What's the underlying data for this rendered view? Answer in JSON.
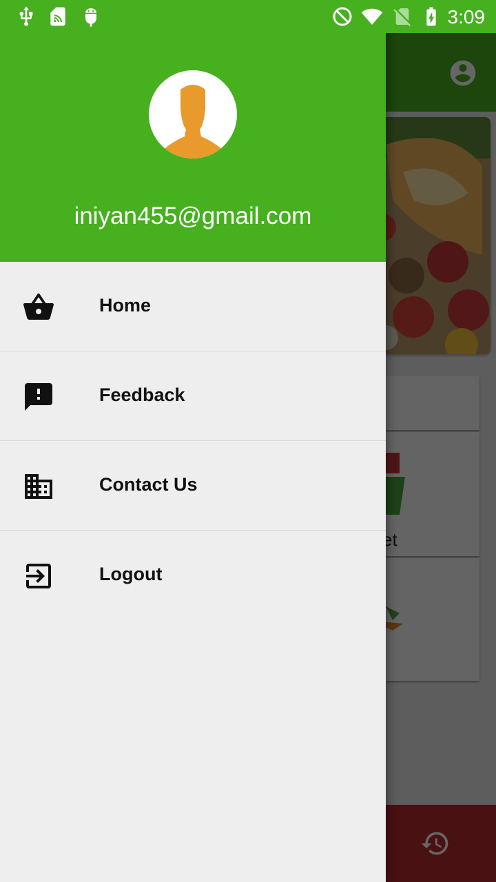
{
  "status_bar": {
    "time": "3:09"
  },
  "drawer": {
    "user_email": "iniyan455@gmail.com",
    "menu_items": [
      {
        "label": "Home",
        "icon": "basket-icon"
      },
      {
        "label": "Feedback",
        "icon": "feedback-icon"
      },
      {
        "label": "Contact Us",
        "icon": "building-icon"
      },
      {
        "label": "Logout",
        "icon": "logout-icon"
      }
    ]
  },
  "background": {
    "card_partial_label": "ket"
  },
  "colors": {
    "primary_green": "#46b01f",
    "drawer_bg": "#eeeeee",
    "bottom_bar_red": "#b62b2f",
    "avatar_orange": "#e89a2c"
  }
}
